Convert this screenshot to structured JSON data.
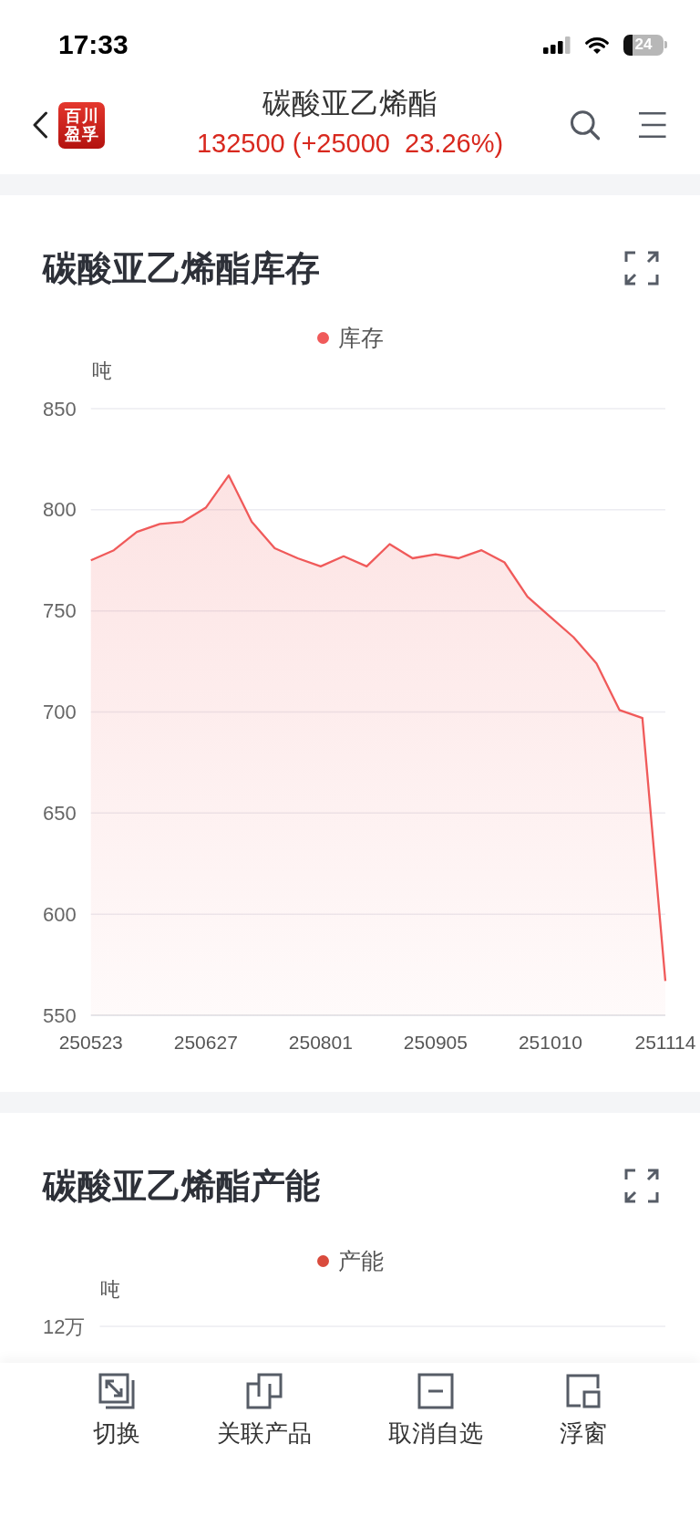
{
  "status_bar": {
    "time": "17:33",
    "battery": "24"
  },
  "header": {
    "logo": [
      "百川",
      "盈孚"
    ],
    "title": "碳酸亚乙烯酯",
    "quote": "132500 (+25000  23.26%)"
  },
  "cards": [
    {
      "title": "碳酸亚乙烯酯库存",
      "chart_data": {
        "type": "area",
        "ylabel": "吨",
        "grid": true,
        "categories": [
          "250523",
          null,
          null,
          null,
          null,
          "250627",
          null,
          null,
          null,
          null,
          "250801",
          null,
          null,
          null,
          null,
          "250905",
          null,
          null,
          null,
          null,
          "251010",
          null,
          null,
          null,
          null,
          "251114"
        ],
        "ylim": [
          550,
          850
        ],
        "yticks": [
          550,
          600,
          650,
          700,
          750,
          800,
          850
        ],
        "series": [
          {
            "name": "库存",
            "color": "#f05a5a",
            "values": [
              775,
              780,
              789,
              793,
              794,
              801,
              817,
              794,
              781,
              776,
              772,
              777,
              772,
              783,
              776,
              778,
              776,
              780,
              774,
              757,
              747,
              737,
              724,
              701,
              697,
              567
            ]
          }
        ]
      }
    },
    {
      "title": "碳酸亚乙烯酯产能",
      "chart": {
        "legend": [
          {
            "label": "产能",
            "color": "#d94b3d"
          }
        ],
        "unit": "吨",
        "y_tick_labels": [
          "12万"
        ]
      }
    }
  ],
  "toolbar": [
    {
      "kind": "switch",
      "label": "切换"
    },
    {
      "kind": "related",
      "label": "关联产品"
    },
    {
      "kind": "unfavorite",
      "label": "取消自选"
    },
    {
      "kind": "float",
      "label": "浮窗"
    }
  ]
}
